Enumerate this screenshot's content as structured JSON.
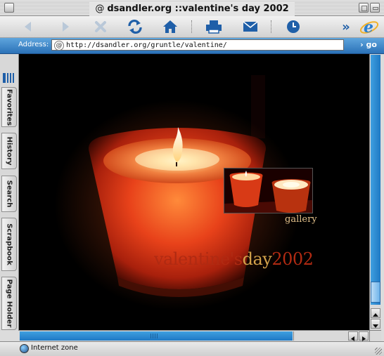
{
  "window": {
    "title": "dsandler.org ::valentine's day 2002",
    "title_icon": "@"
  },
  "toolbar": {
    "buttons": [
      {
        "name": "back",
        "icon": "back-arrow-icon",
        "enabled": false
      },
      {
        "name": "forward",
        "icon": "forward-arrow-icon",
        "enabled": false
      },
      {
        "name": "stop",
        "icon": "stop-x-icon",
        "enabled": false
      },
      {
        "name": "refresh",
        "icon": "refresh-icon",
        "enabled": true
      },
      {
        "name": "home",
        "icon": "home-icon",
        "enabled": true
      },
      {
        "name": "print",
        "icon": "printer-icon",
        "enabled": true
      },
      {
        "name": "mail",
        "icon": "mail-icon",
        "enabled": true
      },
      {
        "name": "history",
        "icon": "clock-icon",
        "enabled": true
      },
      {
        "name": "more",
        "icon": "chevron-double-right-icon",
        "enabled": true
      },
      {
        "name": "ie-logo",
        "icon": "ie-logo-icon",
        "enabled": true
      }
    ],
    "more_glyph": "»"
  },
  "address": {
    "label": "Address:",
    "url": "http://dsandler.org/gruntle/valentine/",
    "go_label": "› go"
  },
  "explorer_tabs": [
    "Favorites",
    "History",
    "Search",
    "Scrapbook",
    "Page Holder"
  ],
  "page": {
    "gallery_label": "gallery",
    "headline": {
      "part1": "valentine's",
      "part2": "day",
      "part3": "2002"
    }
  },
  "status": {
    "zone_text": "Internet zone"
  },
  "scrollbars": {
    "vertical_position": 1.0,
    "horizontal_position": 0.0
  },
  "colors": {
    "accent_blue": "#2b7fd0",
    "headline_red": "#b02a12",
    "headline_gold": "#d2a14a",
    "gallery_text": "#e2c08a",
    "page_background": "#000000"
  }
}
